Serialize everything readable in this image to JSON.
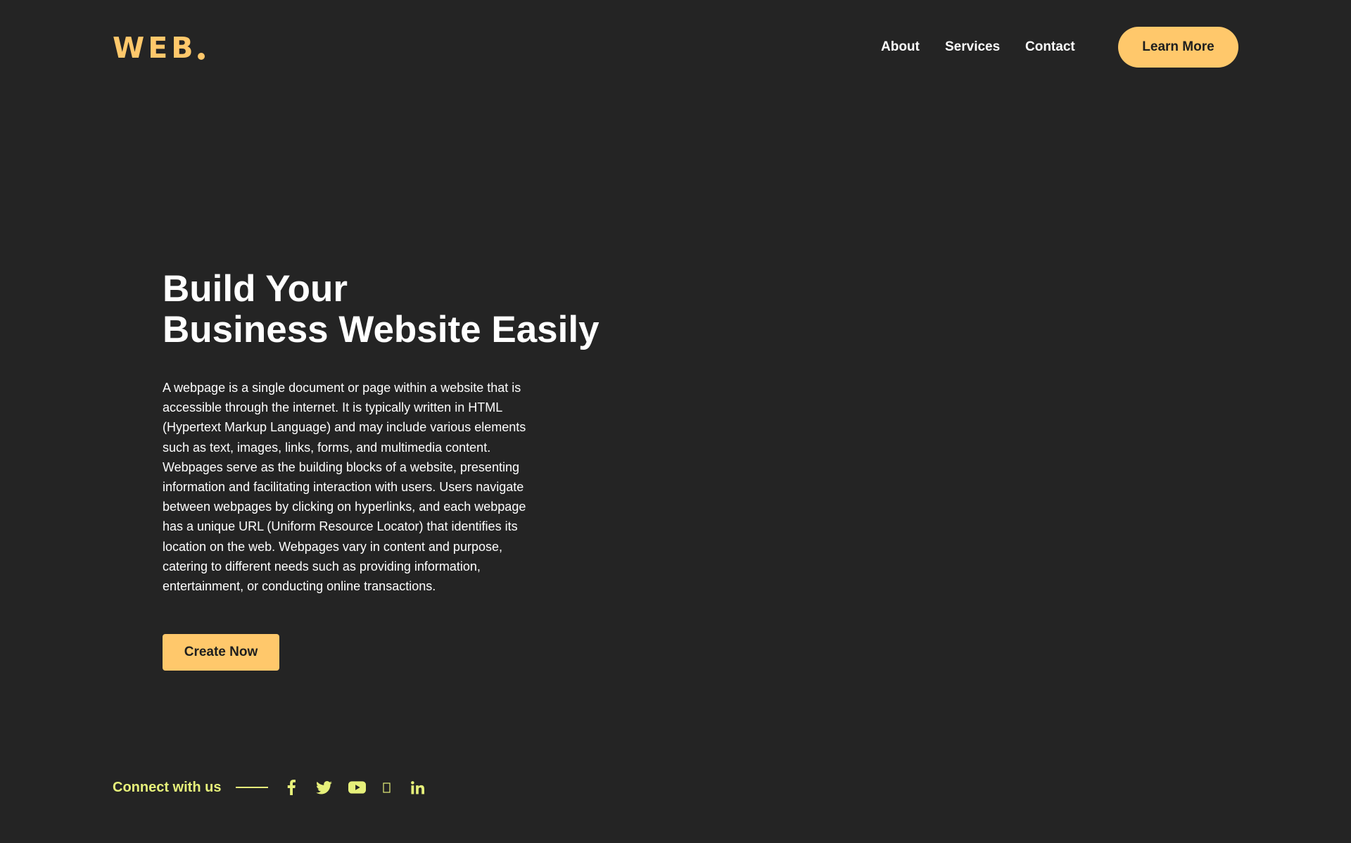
{
  "header": {
    "logo_text": "WEB",
    "nav": {
      "about": "About",
      "services": "Services",
      "contact": "Contact"
    },
    "cta_label": "Learn More"
  },
  "hero": {
    "title_line1": "Build Your",
    "title_line2": "Business Website Easily",
    "description": "A webpage is a single document or page within a website that is accessible through the internet. It is typically written in HTML (Hypertext Markup Language) and may include various elements such as text, images, links, forms, and multimedia content. Webpages serve as the building blocks of a website, presenting information and facilitating interaction with users. Users navigate between webpages by clicking on hyperlinks, and each webpage has a unique URL (Uniform Resource Locator) that identifies its location on the web. Webpages vary in content and purpose, catering to different needs such as providing information, entertainment, or conducting online transactions.",
    "button_label": "Create Now"
  },
  "footer": {
    "connect_label": "Connect with us",
    "social_icons": [
      "facebook-icon",
      "twitter-icon",
      "youtube-icon",
      "instagram-icon",
      "linkedin-icon"
    ]
  },
  "colors": {
    "background": "#242424",
    "accent": "#FFC86B",
    "social_accent": "#E6F07A",
    "text": "#FFFFFF"
  }
}
